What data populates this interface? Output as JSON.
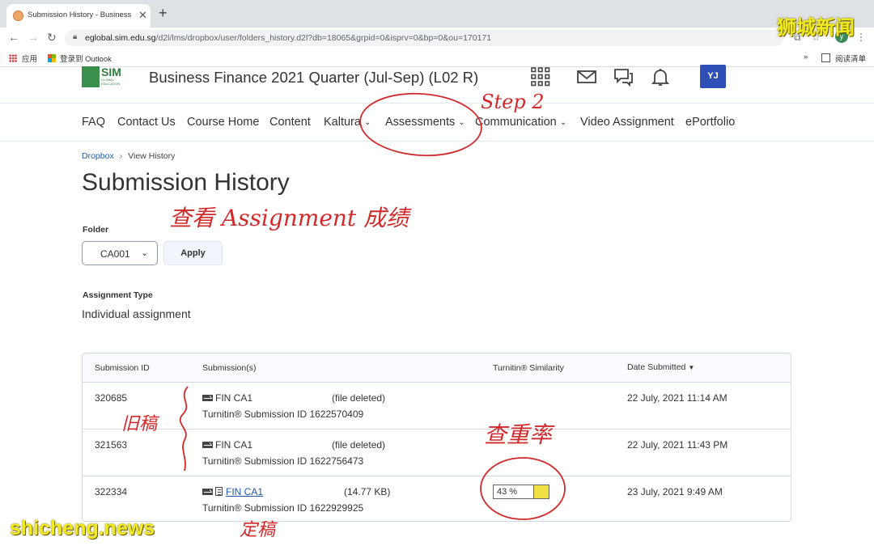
{
  "browser": {
    "tab_title": "Submission History - Business",
    "url_domain": "eglobal.sim.edu.sg",
    "url_path": "/d2l/lms/dropbox/user/folders_history.d2l?db=18065&grpid=0&isprv=0&bp=0&ou=170171",
    "profile_initial": "y",
    "bookmarks": [
      "应用",
      "登录到 Outlook"
    ],
    "more_bookmarks": "»",
    "reading_list": "阅读清单"
  },
  "header": {
    "logo_text": "SIM",
    "logo_sub": "GLOBAL EDUCATION",
    "course_title": "Business Finance 2021 Quarter (Jul-Sep) (L02 R)",
    "avatar_initials": "YJ"
  },
  "nav": {
    "items": [
      {
        "label": "FAQ",
        "dropdown": false
      },
      {
        "label": "Contact Us",
        "dropdown": false
      },
      {
        "label": "Course Home",
        "dropdown": false
      },
      {
        "label": "Content",
        "dropdown": false
      },
      {
        "label": "Kaltura",
        "dropdown": true
      },
      {
        "label": "Assessments",
        "dropdown": true
      },
      {
        "label": "Communication",
        "dropdown": true
      },
      {
        "label": "Video Assignment",
        "dropdown": false
      },
      {
        "label": "ePortfolio",
        "dropdown": false
      }
    ]
  },
  "breadcrumb": {
    "parent": "Dropbox",
    "current": "View History"
  },
  "page_title": "Submission History",
  "folder": {
    "label": "Folder",
    "selected": "CA001",
    "apply_label": "Apply"
  },
  "assignment_type": {
    "label": "Assignment Type",
    "value": "Individual assignment"
  },
  "table": {
    "headers": {
      "id": "Submission ID",
      "submissions": "Submission(s)",
      "similarity": "Turnitin® Similarity",
      "date": "Date Submitted"
    },
    "rows": [
      {
        "id": "320685",
        "file": "FIN CA1",
        "file_status": "(file deleted)",
        "turnitin": "Turnitin® Submission ID 1622570409",
        "similarity": "",
        "date": "22 July, 2021 11:14 AM"
      },
      {
        "id": "321563",
        "file": "FIN CA1",
        "file_status": "(file deleted)",
        "turnitin": "Turnitin® Submission ID 1622756473",
        "similarity": "",
        "date": "22 July, 2021 11:43 PM"
      },
      {
        "id": "322334",
        "file": "FIN CA1",
        "file_status": "(14.77 KB)",
        "turnitin": "Turnitin® Submission ID 1622929925",
        "similarity": "43 %",
        "similarity_value": 43,
        "date": "23 July, 2021 9:49 AM"
      }
    ]
  },
  "annotations": {
    "step": "Step 2",
    "view_grades": "查看 Assignment 成绩",
    "old_draft": "旧稿",
    "plagiarism_rate": "查重率",
    "final_draft": "定稿"
  },
  "watermarks": {
    "top": "狮城新闻",
    "bottom": "shicheng.news"
  },
  "colors": {
    "accent_blue": "#1d5aa8",
    "avatar_blue": "#2e4fb5",
    "annotation_red": "#d22a2a",
    "similarity_yellow": "#efe046",
    "watermark_yellow": "#f1ea1c"
  }
}
